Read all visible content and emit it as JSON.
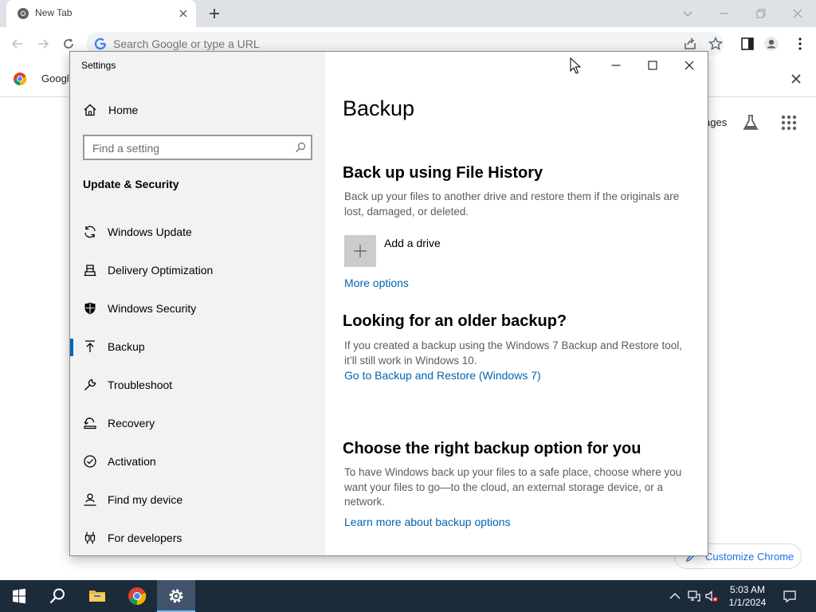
{
  "browser": {
    "tab_title": "New Tab",
    "omnibox_placeholder": "Search Google or type a URL",
    "banner_text": "Google",
    "ntp_images_text": "ages",
    "customize_label": "Customize Chrome"
  },
  "settings": {
    "window_title": "Settings",
    "sidebar": {
      "home_label": "Home",
      "search_placeholder": "Find a setting",
      "section_title": "Update & Security",
      "items": [
        {
          "label": "Windows Update",
          "icon": "refresh-icon"
        },
        {
          "label": "Delivery Optimization",
          "icon": "delivery-icon"
        },
        {
          "label": "Windows Security",
          "icon": "shield-icon"
        },
        {
          "label": "Backup",
          "icon": "upload-arrow-icon",
          "selected": true
        },
        {
          "label": "Troubleshoot",
          "icon": "wrench-icon"
        },
        {
          "label": "Recovery",
          "icon": "recovery-icon"
        },
        {
          "label": "Activation",
          "icon": "check-circle-icon"
        },
        {
          "label": "Find my device",
          "icon": "person-pin-icon"
        },
        {
          "label": "For developers",
          "icon": "developer-icon"
        }
      ]
    },
    "content": {
      "page_title": "Backup",
      "file_history": {
        "heading": "Back up using File History",
        "description": "Back up your files to another drive and restore them if the originals are lost, damaged, or deleted.",
        "add_drive_label": "Add a drive",
        "more_options_link": "More options"
      },
      "older_backup": {
        "heading": "Looking for an older backup?",
        "description": "If you created a backup using the Windows 7 Backup and Restore tool, it’ll still work in Windows 10.",
        "link": "Go to Backup and Restore (Windows 7)"
      },
      "choose_option": {
        "heading": "Choose the right backup option for you",
        "description": "To have Windows back up your files to a safe place, choose where you want your files to go—to the cloud, an external storage device, or a network.",
        "link": "Learn more about backup options"
      }
    }
  },
  "taskbar": {
    "time": "5:03 AM",
    "date": "1/1/2024"
  },
  "colors": {
    "accent": "#0067c0",
    "link": "#0063b1",
    "taskbar": "#1c2b3a",
    "sidebar_bg": "#f2f2f2"
  }
}
